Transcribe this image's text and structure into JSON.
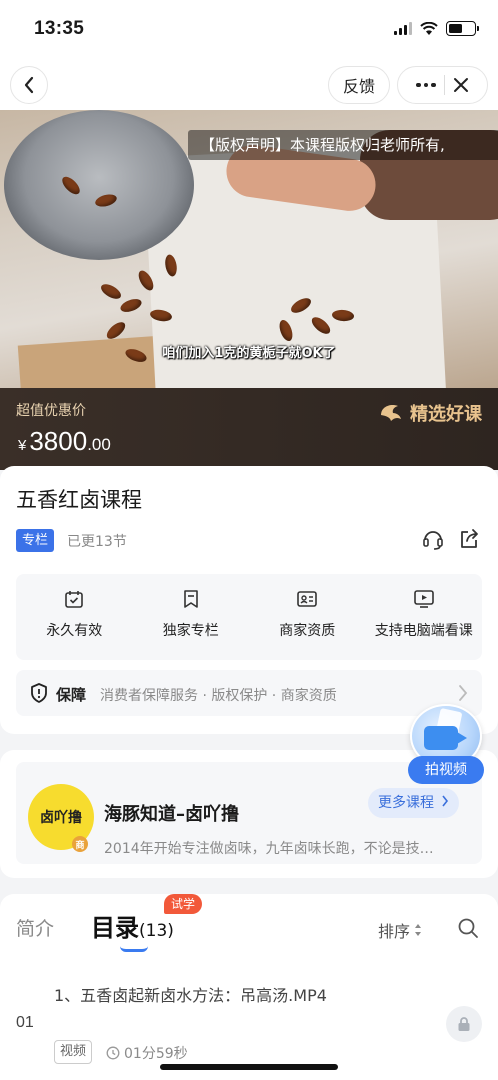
{
  "status_bar": {
    "time": "13:35"
  },
  "nav": {
    "feedback_label": "反馈"
  },
  "video": {
    "copyright_notice": "【版权声明】本课程版权归老师所有,",
    "subtitle": "咱们加入1克的黄栀子就OK了"
  },
  "price_banner": {
    "label": "超值优惠价",
    "currency": "¥",
    "price_integer": "3800",
    "price_decimal": ".00",
    "premium_label": "精选好课"
  },
  "course": {
    "title": "五香红卤课程",
    "tag": "专栏",
    "updated": "已更13节",
    "features": [
      {
        "icon": "calendar-check-icon",
        "label": "永久有效"
      },
      {
        "icon": "bookmark-icon",
        "label": "独家专栏"
      },
      {
        "icon": "id-card-icon",
        "label": "商家资质"
      },
      {
        "icon": "monitor-play-icon",
        "label": "支持电脑端看课"
      }
    ],
    "guarantee": {
      "title": "保障",
      "details": "消费者保障服务 · 版权保护 · 商家资质"
    }
  },
  "shop": {
    "avatar_text": "卤吖撸",
    "badge": "商",
    "name": "海豚知道–卤吖撸",
    "description": "2014年开始专注做卤味，九年卤味长跑，不论是技…",
    "more_label": "更多课程"
  },
  "float_button": {
    "label": "拍视频"
  },
  "catalog": {
    "tab_intro": "简介",
    "tab_catalog": "目录",
    "catalog_count": "(13)",
    "trial_badge": "试学",
    "sort_label": "排序",
    "lessons": [
      {
        "title": "1、五香卤起新卤水方法：吊高汤.MP4",
        "number": "01",
        "type": "视频",
        "duration": "01分59秒"
      }
    ]
  },
  "colors": {
    "accent_blue": "#3a7bf0",
    "price_banner_bg": "#3a2f28",
    "premium_gold": "#e8c38e",
    "trial_red": "#f2593a"
  }
}
